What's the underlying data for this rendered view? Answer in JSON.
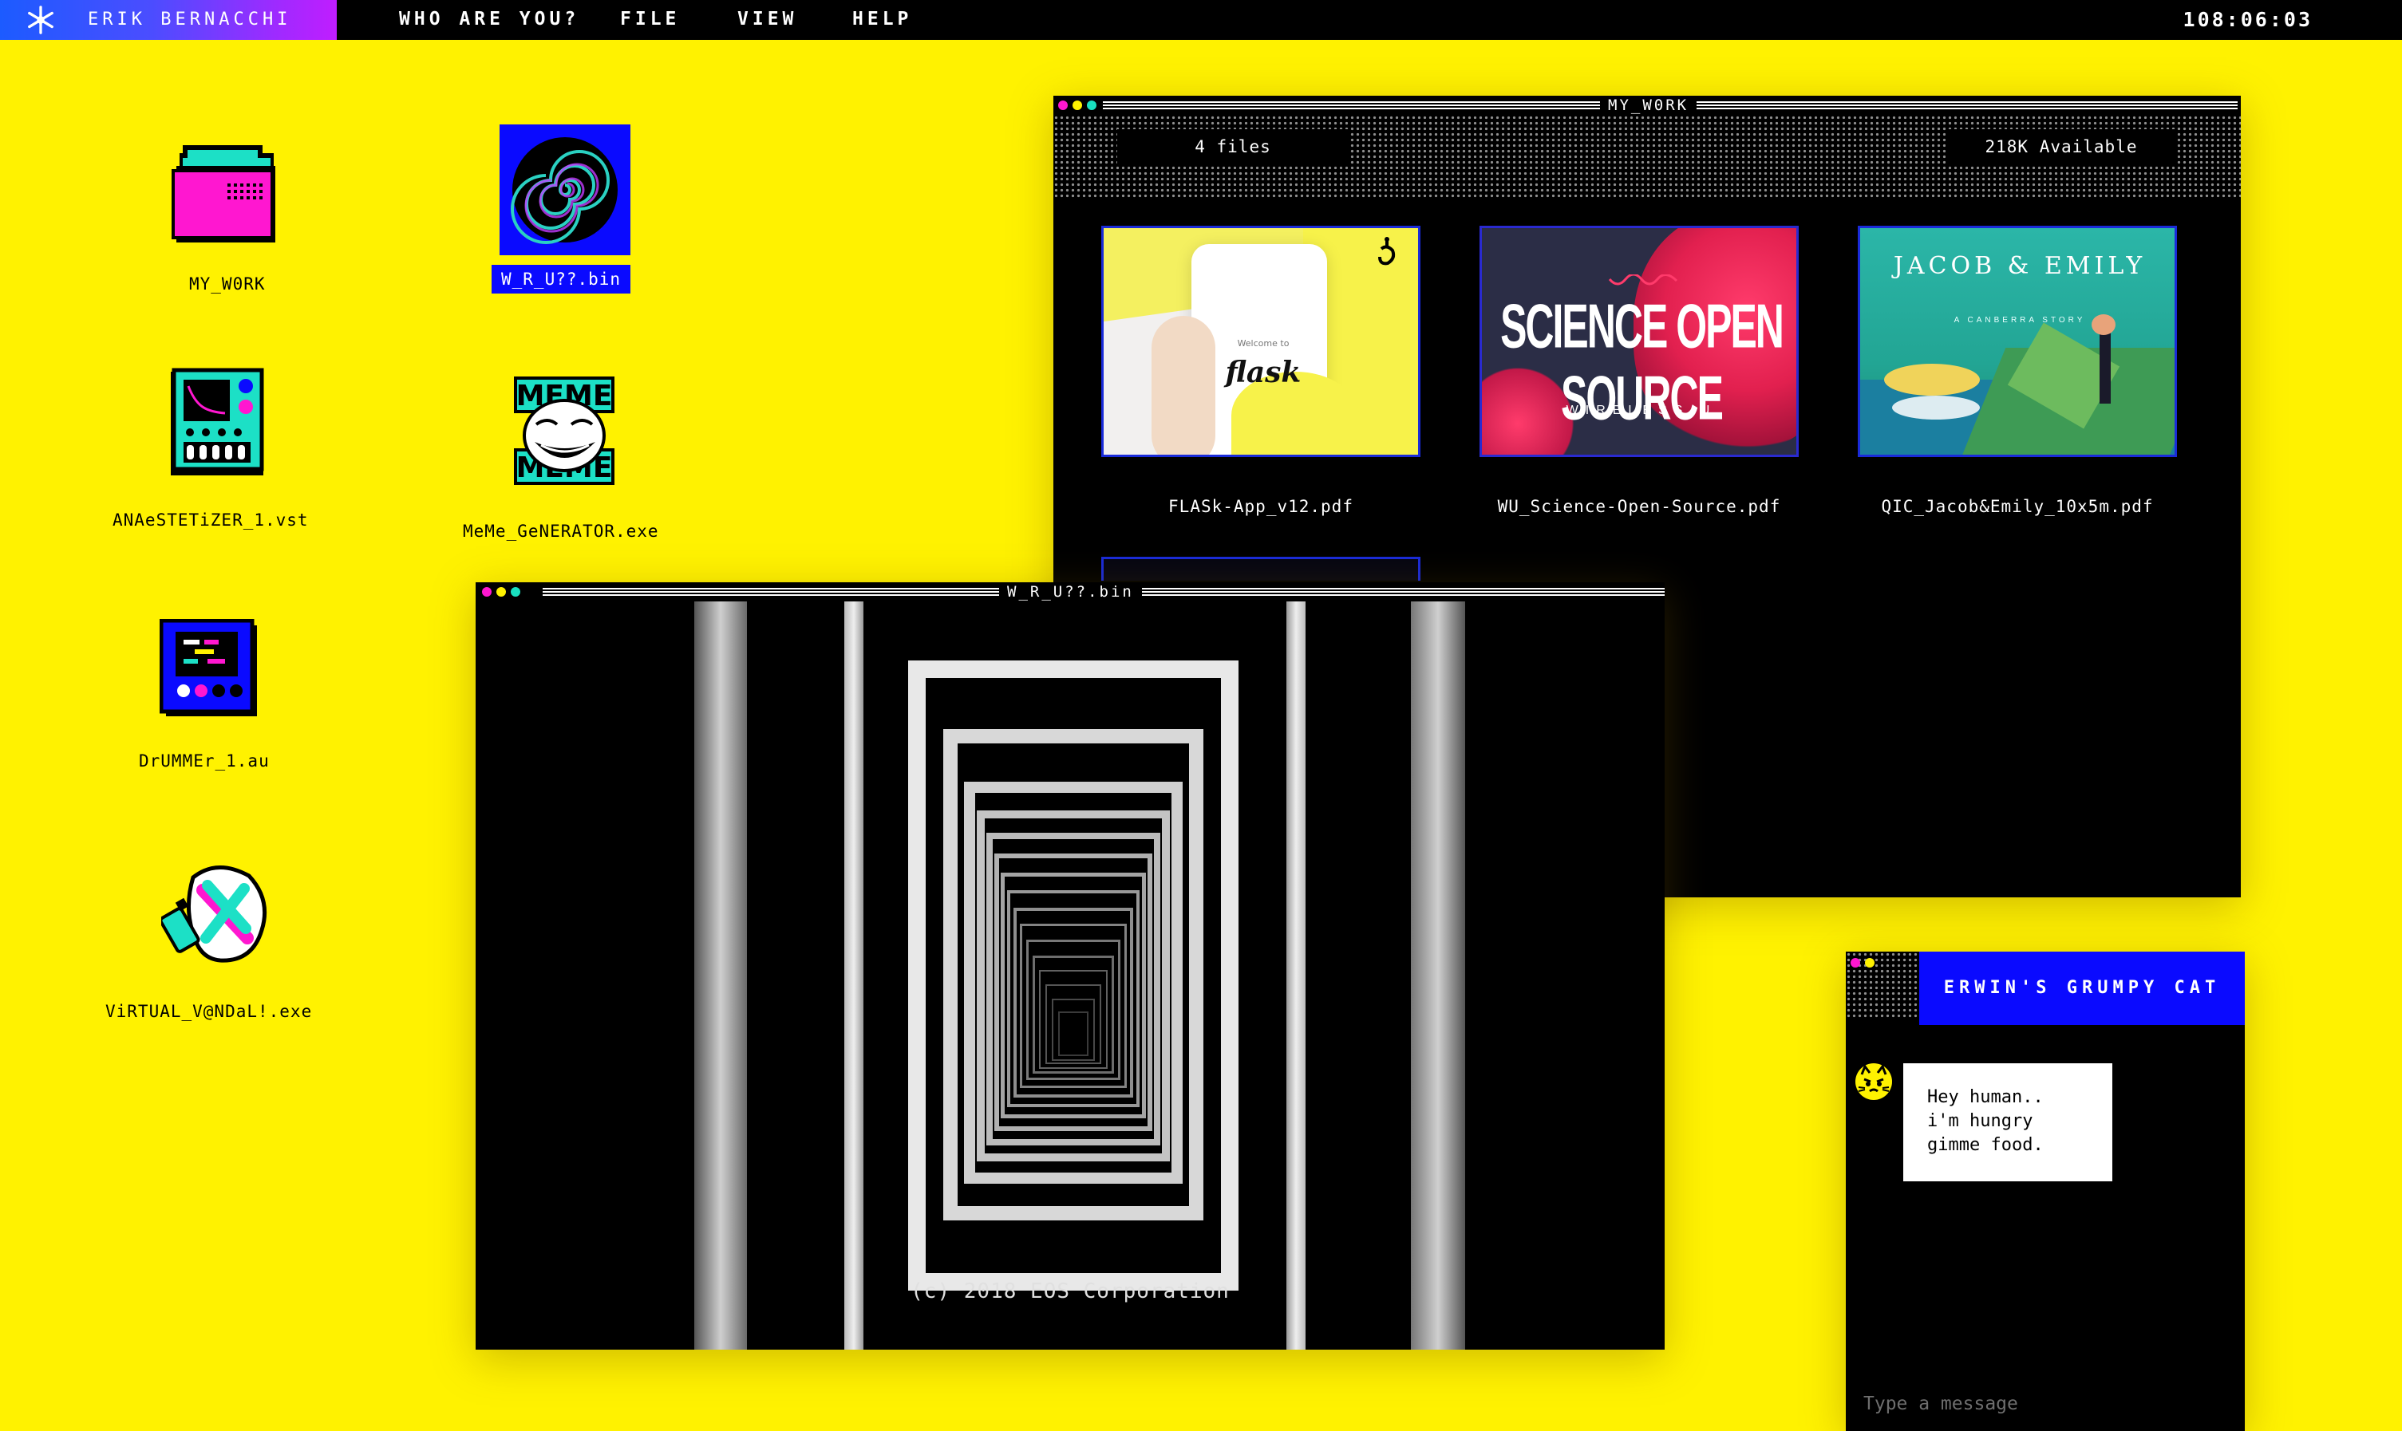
{
  "topbar": {
    "brand": "ERIK BERNACCHI",
    "menu": [
      "WHO ARE YOU?",
      "FILE",
      "VIEW",
      "HELP"
    ],
    "clock": "108:06:03"
  },
  "desktop": {
    "icons": [
      {
        "label": "MY_W0RK",
        "icon": "folder-icon"
      },
      {
        "label": "W_R_U??.bin",
        "icon": "spiral-icon",
        "selected": true
      },
      {
        "label": "ANAeSTETiZER_1.vst",
        "icon": "synth-icon"
      },
      {
        "label": "MeMe_GeNERATOR.exe",
        "icon": "meme-icon"
      },
      {
        "label": "DrUMMEr_1.au",
        "icon": "drum-machine-icon"
      },
      {
        "label": "ViRTUAL_V@NDaL!.exe",
        "icon": "vandal-mask-icon"
      }
    ]
  },
  "mywork_window": {
    "title": "MY_W0RK",
    "file_count": "4 files",
    "available": "218K Available",
    "files": [
      {
        "name": "FLASk-App_v12.pdf",
        "thumb_text": "flask",
        "thumb_sub": "Welcome to"
      },
      {
        "name": "WU_Science-Open-Source.pdf",
        "thumb_text": "SCIENCE OPEN SOURCE",
        "thumb_sub": "WIRELESS/U"
      },
      {
        "name": "QIC_Jacob&Emily_10x5m.pdf",
        "thumb_text": "JACOB & EMILY",
        "thumb_sub": "A CANBERRA STORY"
      }
    ]
  },
  "wru_window": {
    "title": "W_R_U??.bin",
    "copyright": "(c) 2018 EOS Corporation"
  },
  "chat_window": {
    "title": "ERWIN'S GRUMPY CAT",
    "message": "Hey human..\ni'm hungry\ngimme food.",
    "placeholder": "Type a message"
  },
  "colors": {
    "background": "#fff200",
    "accent_blue": "#0a0aff",
    "magenta": "#ff17d0",
    "teal": "#19e0c0"
  }
}
